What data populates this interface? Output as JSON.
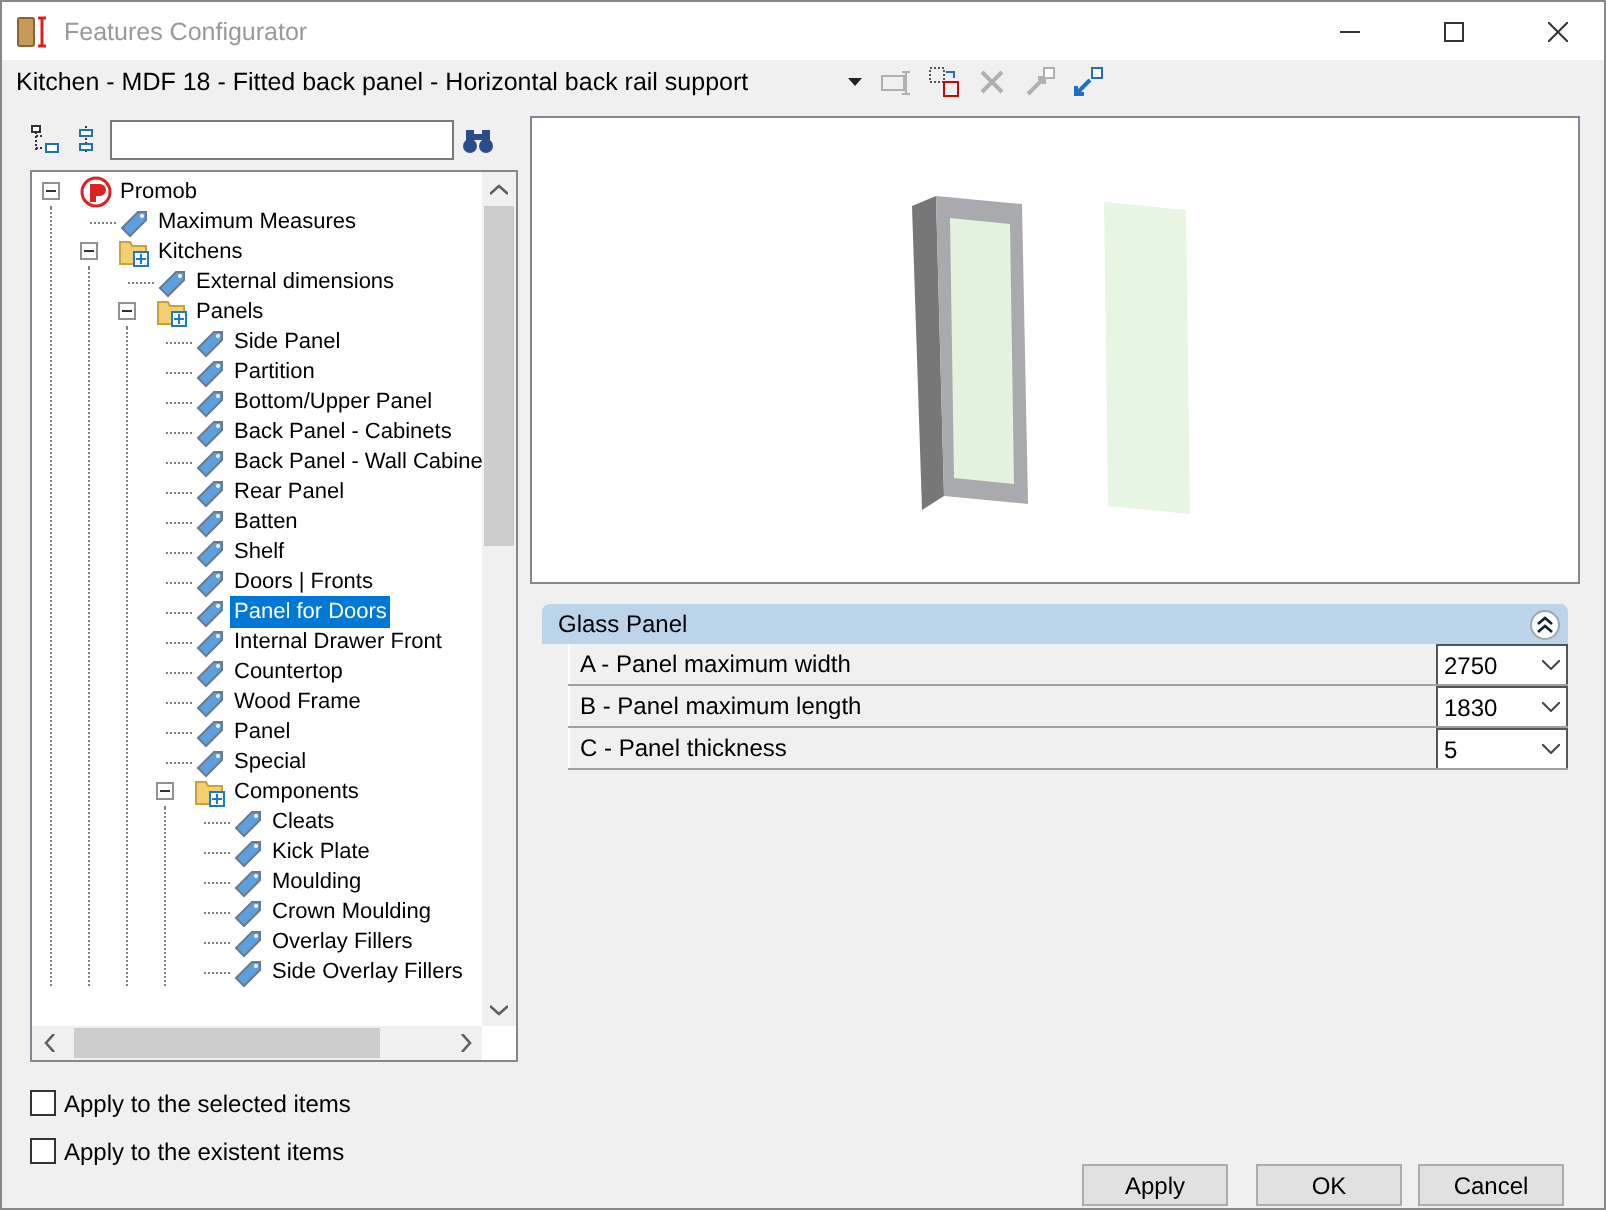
{
  "window": {
    "title": "Features Configurator"
  },
  "selector": {
    "value": "Kitchen - MDF 18 - Fitted back panel - Horizontal back rail support"
  },
  "toolbar": [
    {
      "kind": "rename",
      "disabled": true
    },
    {
      "kind": "replace",
      "disabled": false
    },
    {
      "kind": "delete",
      "disabled": true
    },
    {
      "kind": "export",
      "disabled": true
    },
    {
      "kind": "import",
      "disabled": false
    }
  ],
  "tree": [
    {
      "label": "Promob",
      "kind": "root",
      "expanded": true,
      "selected": false,
      "children": [
        {
          "label": "Maximum Measures",
          "kind": "item",
          "selected": false
        },
        {
          "label": "Kitchens",
          "kind": "folder",
          "expanded": true,
          "selected": false,
          "children": [
            {
              "label": "External dimensions",
              "kind": "item",
              "selected": false
            },
            {
              "label": "Panels",
              "kind": "folder",
              "expanded": true,
              "selected": false,
              "children": [
                {
                  "label": "Side Panel",
                  "kind": "item",
                  "selected": false
                },
                {
                  "label": "Partition",
                  "kind": "item",
                  "selected": false
                },
                {
                  "label": "Bottom/Upper Panel",
                  "kind": "item",
                  "selected": false
                },
                {
                  "label": "Back Panel - Cabinets",
                  "kind": "item",
                  "selected": false
                },
                {
                  "label": "Back Panel - Wall Cabine",
                  "kind": "item",
                  "selected": false
                },
                {
                  "label": "Rear Panel",
                  "kind": "item",
                  "selected": false
                },
                {
                  "label": "Batten",
                  "kind": "item",
                  "selected": false
                },
                {
                  "label": "Shelf",
                  "kind": "item",
                  "selected": false
                },
                {
                  "label": "Doors | Fronts",
                  "kind": "item",
                  "selected": false
                },
                {
                  "label": "Panel for Doors",
                  "kind": "item",
                  "selected": true
                },
                {
                  "label": "Internal Drawer Front",
                  "kind": "item",
                  "selected": false
                },
                {
                  "label": "Countertop",
                  "kind": "item",
                  "selected": false
                },
                {
                  "label": "Wood Frame",
                  "kind": "item",
                  "selected": false
                },
                {
                  "label": "Panel",
                  "kind": "item",
                  "selected": false
                },
                {
                  "label": "Special",
                  "kind": "item",
                  "selected": false
                },
                {
                  "label": "Components",
                  "kind": "folder",
                  "expanded": true,
                  "selected": false,
                  "children": [
                    {
                      "label": "Cleats",
                      "kind": "item",
                      "selected": false
                    },
                    {
                      "label": " Kick Plate",
                      "kind": "item",
                      "selected": false
                    },
                    {
                      "label": "Moulding",
                      "kind": "item",
                      "selected": false
                    },
                    {
                      "label": "Crown Moulding",
                      "kind": "item",
                      "selected": false
                    },
                    {
                      "label": " Overlay Fillers",
                      "kind": "item",
                      "selected": false
                    },
                    {
                      "label": "Side Overlay Fillers",
                      "kind": "item",
                      "selected": false
                    }
                  ]
                }
              ]
            }
          ]
        }
      ]
    }
  ],
  "section": {
    "title": "Glass Panel",
    "expanded": true,
    "properties": [
      {
        "label": "A - Panel maximum width",
        "value": "2750"
      },
      {
        "label": "B - Panel maximum length",
        "value": "1830"
      },
      {
        "label": "C - Panel thickness",
        "value": "5"
      }
    ]
  },
  "options": [
    {
      "label": "Apply to the selected items",
      "checked": false
    },
    {
      "label": "Apply to the existent items",
      "checked": false
    }
  ],
  "buttons": [
    "Apply",
    "OK",
    "Cancel"
  ]
}
